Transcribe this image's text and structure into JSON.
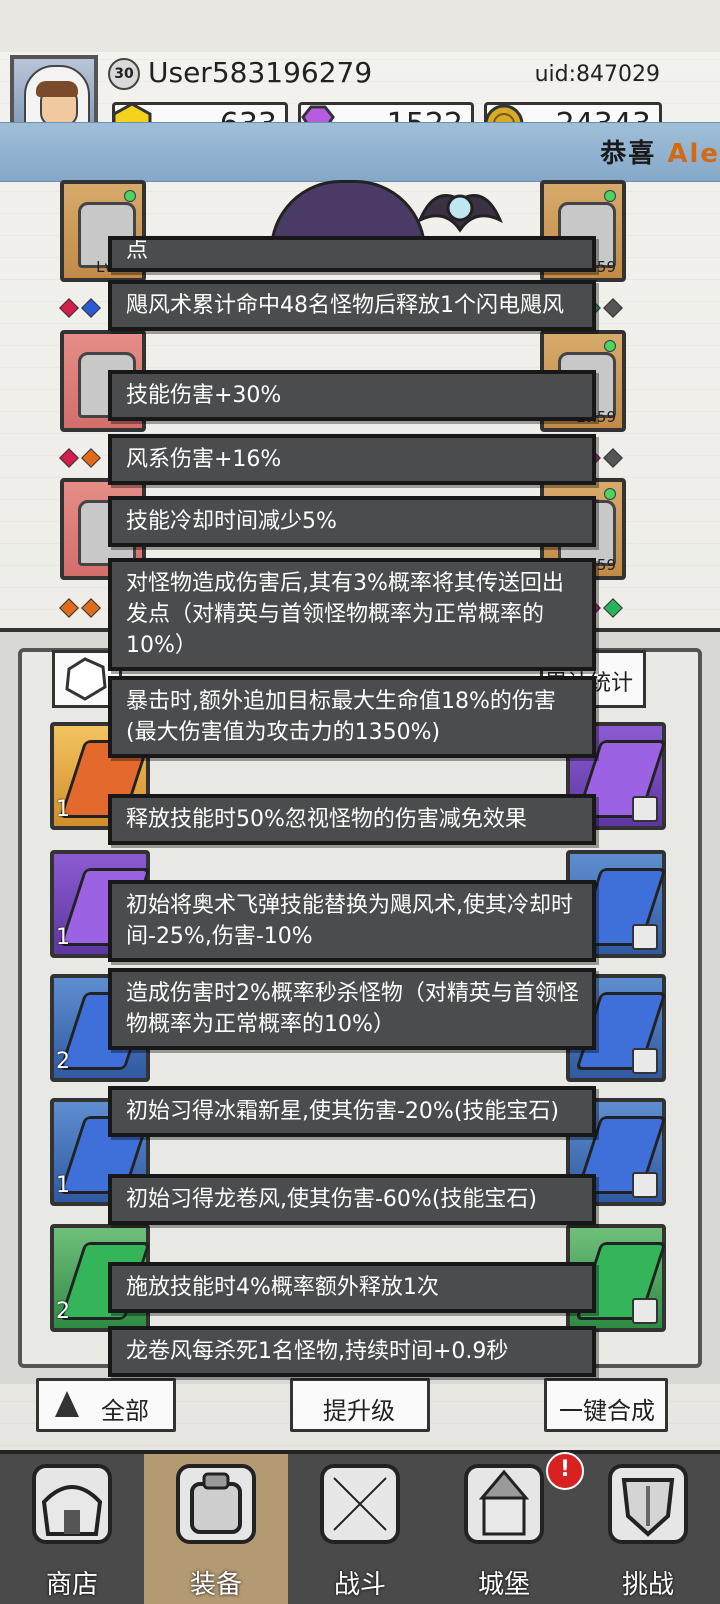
{
  "header": {
    "level": "30",
    "username": "User583196279",
    "uid": "uid:847029",
    "resources": [
      {
        "icon": "gold-hex-icon",
        "value": "633"
      },
      {
        "icon": "purple-gem-icon",
        "value": "1522"
      },
      {
        "icon": "gold-coin-icon",
        "value": "24343"
      }
    ],
    "ticker": {
      "text": "恭喜",
      "highlight": "Ale"
    }
  },
  "equipment": {
    "left_top_level": "Lv.60",
    "right_levels": [
      "Lv.59",
      "Lv.59",
      "Lv.59"
    ]
  },
  "panel": {
    "stats_button": "累计统计",
    "inventory_counts": [
      "1",
      "1",
      "2",
      "1",
      "2"
    ],
    "buttons": {
      "all": "全部",
      "upgrade": "提升级",
      "merge": "一键合成"
    }
  },
  "tooltips": [
    "点",
    "飓风术累计命中48名怪物后释放1个闪电飓风",
    "技能伤害+30%",
    "风系伤害+16%",
    "技能冷却时间减少5%",
    "对怪物造成伤害后,其有3%概率将其传送回出发点（对精英与首领怪物概率为正常概率的10%）",
    "暴击时,额外追加目标最大生命值18%的伤害(最大伤害值为攻击力的1350%)",
    "释放技能时50%忽视怪物的伤害减免效果",
    "初始将奥术飞弹技能替换为飓风术,使其冷却时间-25%,伤害-10%",
    "造成伤害时2%概率秒杀怪物（对精英与首领怪物概率为正常概率的10%）",
    "初始习得冰霜新星,使其伤害-20%(技能宝石)",
    "初始习得龙卷风,使其伤害-60%(技能宝石)",
    "施放技能时4%概率额外释放1次",
    "龙卷风每杀死1名怪物,持续时间+0.9秒"
  ],
  "nav": {
    "items": [
      {
        "label": "商店",
        "icon": "shop-icon"
      },
      {
        "label": "装备",
        "icon": "bag-icon"
      },
      {
        "label": "战斗",
        "icon": "crossed-swords-icon"
      },
      {
        "label": "城堡",
        "icon": "castle-icon"
      },
      {
        "label": "挑战",
        "icon": "shield-icon"
      }
    ],
    "badge": "!"
  },
  "colors": {
    "tooltip_bg": "#4b4c4d",
    "nav_bg": "#4a4a4a",
    "nav_active": "#b39a73",
    "ticker_bg": "#8fb1d0"
  }
}
